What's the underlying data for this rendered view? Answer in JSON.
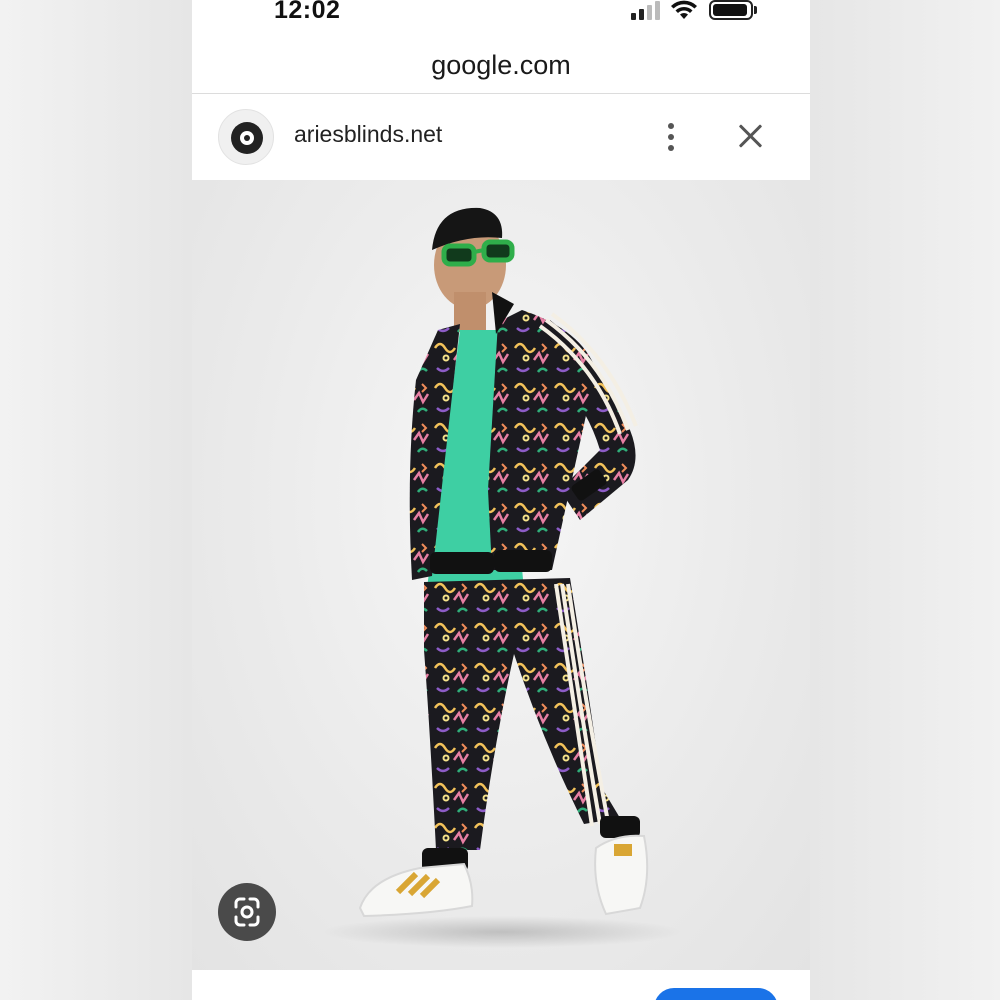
{
  "status_bar": {
    "time": "12:02",
    "signal_icon": "cellular-signal-icon",
    "wifi_icon": "wifi-icon",
    "battery_icon": "battery-icon"
  },
  "browser": {
    "url": "google.com"
  },
  "site": {
    "favicon_icon": "site-favicon-icon",
    "name": "ariesblinds.net",
    "more_icon": "more-vertical-icon",
    "close_icon": "close-icon"
  },
  "image": {
    "lens_icon": "google-lens-icon"
  },
  "colors": {
    "background": "#ffffff",
    "image_background": "#ebebeb",
    "lens_button": "#4a4a4a",
    "accent_blue": "#1a73e8",
    "tee_green": "#3ecfa3",
    "jacket_black": "#1b1a1f",
    "sunglasses_green": "#2fae4a"
  }
}
